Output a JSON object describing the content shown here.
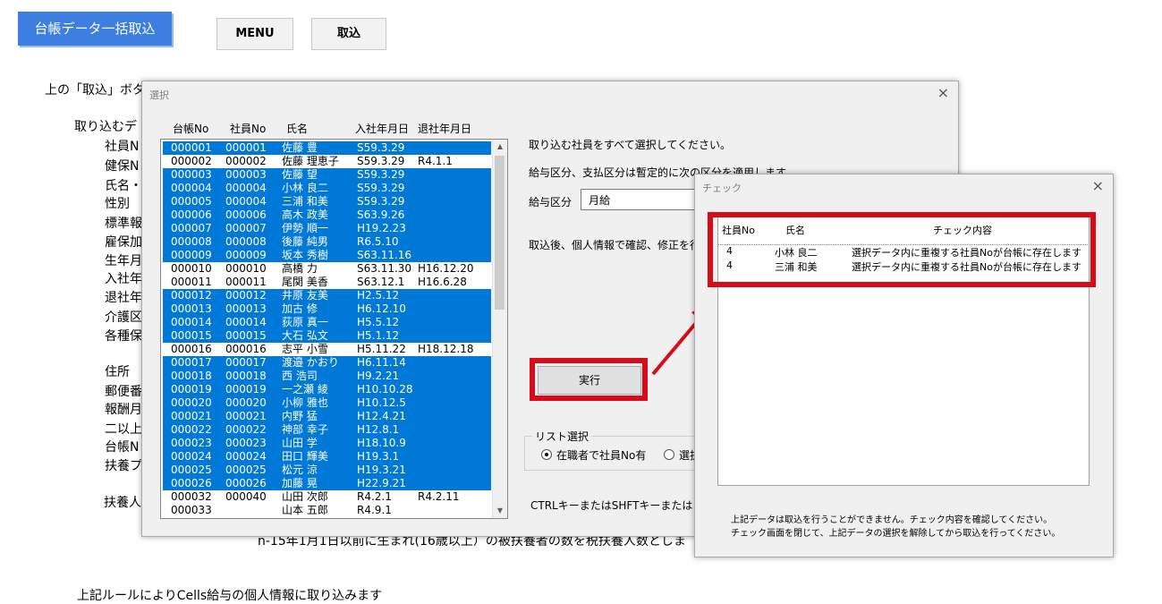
{
  "header": {
    "title": "台帳データ一括取込",
    "menu_button": "MENU",
    "import_button": "取込"
  },
  "sheet": {
    "instruction": "上の「取込」ボタン",
    "section_label": "取り込むデ",
    "fields": [
      "社員N",
      "健保N",
      "氏名・",
      "性別",
      "標準報",
      "雇保加",
      "生年月",
      "入社年",
      "退社年",
      "介護区",
      "各種保"
    ],
    "fields2": [
      "住所",
      "郵便番",
      "報酬月",
      "二以上",
      "台帳N",
      "扶養プ"
    ],
    "dependents_label": "扶養人",
    "bottom_note": "n-15年1月1日以前に生まれ(16歳以上）の被扶養者の数を税扶養人数としま",
    "footer_note": "上記ルールによりCells給与の個人情報に取り込みます"
  },
  "select_dialog": {
    "title": "選択",
    "close": "×",
    "columns": [
      "台帳No",
      "社員No",
      "氏名",
      "入社年月日",
      "退社年月日"
    ],
    "rows": [
      {
        "ledger": "000001",
        "emp": "000001",
        "name": "佐藤 豊",
        "join": "S59.3.29",
        "leave": "",
        "selected": true
      },
      {
        "ledger": "000002",
        "emp": "000002",
        "name": "佐藤 理恵子",
        "join": "S59.3.29",
        "leave": "R4.1.1",
        "selected": false
      },
      {
        "ledger": "000003",
        "emp": "000003",
        "name": "佐藤 望",
        "join": "S59.3.29",
        "leave": "",
        "selected": true
      },
      {
        "ledger": "000004",
        "emp": "000004",
        "name": "小林 良二",
        "join": "S59.3.29",
        "leave": "",
        "selected": true
      },
      {
        "ledger": "000005",
        "emp": "000004",
        "name": "三浦 和美",
        "join": "S59.3.29",
        "leave": "",
        "selected": true
      },
      {
        "ledger": "000006",
        "emp": "000006",
        "name": "高木 政美",
        "join": "S63.9.26",
        "leave": "",
        "selected": true
      },
      {
        "ledger": "000007",
        "emp": "000007",
        "name": "伊勢 順一",
        "join": "H19.2.23",
        "leave": "",
        "selected": true
      },
      {
        "ledger": "000008",
        "emp": "000008",
        "name": "後藤 純男",
        "join": "R6.5.10",
        "leave": "",
        "selected": true
      },
      {
        "ledger": "000009",
        "emp": "000009",
        "name": "坂本 秀樹",
        "join": "S63.11.16",
        "leave": "",
        "selected": true
      },
      {
        "ledger": "000010",
        "emp": "000010",
        "name": "高橋 力",
        "join": "S63.11.30",
        "leave": "H16.12.20",
        "selected": false
      },
      {
        "ledger": "000011",
        "emp": "000011",
        "name": "尾関 美香",
        "join": "S63.12.1",
        "leave": "H16.6.28",
        "selected": false
      },
      {
        "ledger": "000012",
        "emp": "000012",
        "name": "井原 友美",
        "join": "H2.5.12",
        "leave": "",
        "selected": true
      },
      {
        "ledger": "000013",
        "emp": "000013",
        "name": "加古 修",
        "join": "H6.12.10",
        "leave": "",
        "selected": true
      },
      {
        "ledger": "000014",
        "emp": "000014",
        "name": "荻原 真一",
        "join": "H5.5.12",
        "leave": "",
        "selected": true
      },
      {
        "ledger": "000015",
        "emp": "000015",
        "name": "大石 弘文",
        "join": "H5.1.12",
        "leave": "",
        "selected": true
      },
      {
        "ledger": "000016",
        "emp": "000016",
        "name": "志平 小雪",
        "join": "H5.11.22",
        "leave": "H18.12.18",
        "selected": false
      },
      {
        "ledger": "000017",
        "emp": "000017",
        "name": "渡邉 かおり",
        "join": "H6.11.14",
        "leave": "",
        "selected": true
      },
      {
        "ledger": "000018",
        "emp": "000018",
        "name": "西 浩司",
        "join": "H9.2.21",
        "leave": "",
        "selected": true
      },
      {
        "ledger": "000019",
        "emp": "000019",
        "name": "一之瀬 綾",
        "join": "H10.10.28",
        "leave": "",
        "selected": true
      },
      {
        "ledger": "000020",
        "emp": "000020",
        "name": "小柳 雅也",
        "join": "H10.12.5",
        "leave": "",
        "selected": true
      },
      {
        "ledger": "000021",
        "emp": "000021",
        "name": "内野 猛",
        "join": "H12.4.21",
        "leave": "",
        "selected": true
      },
      {
        "ledger": "000022",
        "emp": "000022",
        "name": "神部 幸子",
        "join": "H12.8.1",
        "leave": "",
        "selected": true
      },
      {
        "ledger": "000023",
        "emp": "000023",
        "name": "山田 学",
        "join": "H18.10.9",
        "leave": "",
        "selected": true
      },
      {
        "ledger": "000024",
        "emp": "000024",
        "name": "田口 輝美",
        "join": "H19.3.1",
        "leave": "",
        "selected": true
      },
      {
        "ledger": "000025",
        "emp": "000025",
        "name": "松元 涼",
        "join": "H19.3.21",
        "leave": "",
        "selected": true
      },
      {
        "ledger": "000026",
        "emp": "000026",
        "name": "加藤 晃",
        "join": "H22.9.21",
        "leave": "",
        "selected": true
      },
      {
        "ledger": "000032",
        "emp": "000040",
        "name": "山田 次郎",
        "join": "R4.2.1",
        "leave": "R4.2.11",
        "selected": false
      },
      {
        "ledger": "000033",
        "emp": "",
        "name": "山本 五郎",
        "join": "R4.9.1",
        "leave": "",
        "selected": false
      }
    ],
    "msg_select_all": "取り込む社員をすべて選択してください。",
    "msg_salary": "給与区分、支払区分は暫定的に次の区分を適用します。",
    "salary_label": "給与区分",
    "salary_value": "月給",
    "msg_after": "取込後、個人情報で確認、修正を行っ",
    "execute_button": "実行",
    "list_group_label": "リスト選択",
    "radio_employed": "在職者で社員No有",
    "radio_other": "選択",
    "ctrl_hint": "CTRLキーまたはSHFTキーまたはドラッ"
  },
  "check_dialog": {
    "title": "チェック",
    "close": "×",
    "columns": [
      "社員No",
      "氏名",
      "チェック内容"
    ],
    "rows": [
      {
        "emp": "4",
        "name": "小林 良二",
        "content": "選択データ内に重複する社員Noが台帳に存在します"
      },
      {
        "emp": "4",
        "name": "三浦 和美",
        "content": "選択データ内に重複する社員Noが台帳に存在します"
      }
    ],
    "note_line1": "上記データは取込を行うことができません。チェック内容を確認してください。",
    "note_line2": "チェック画面を閉じて、上記データの選択を解除してから取込を行ってください。"
  },
  "colors": {
    "selection": "#0078d7",
    "highlight": "#d70c18",
    "title_button": "#3d7fe0"
  }
}
